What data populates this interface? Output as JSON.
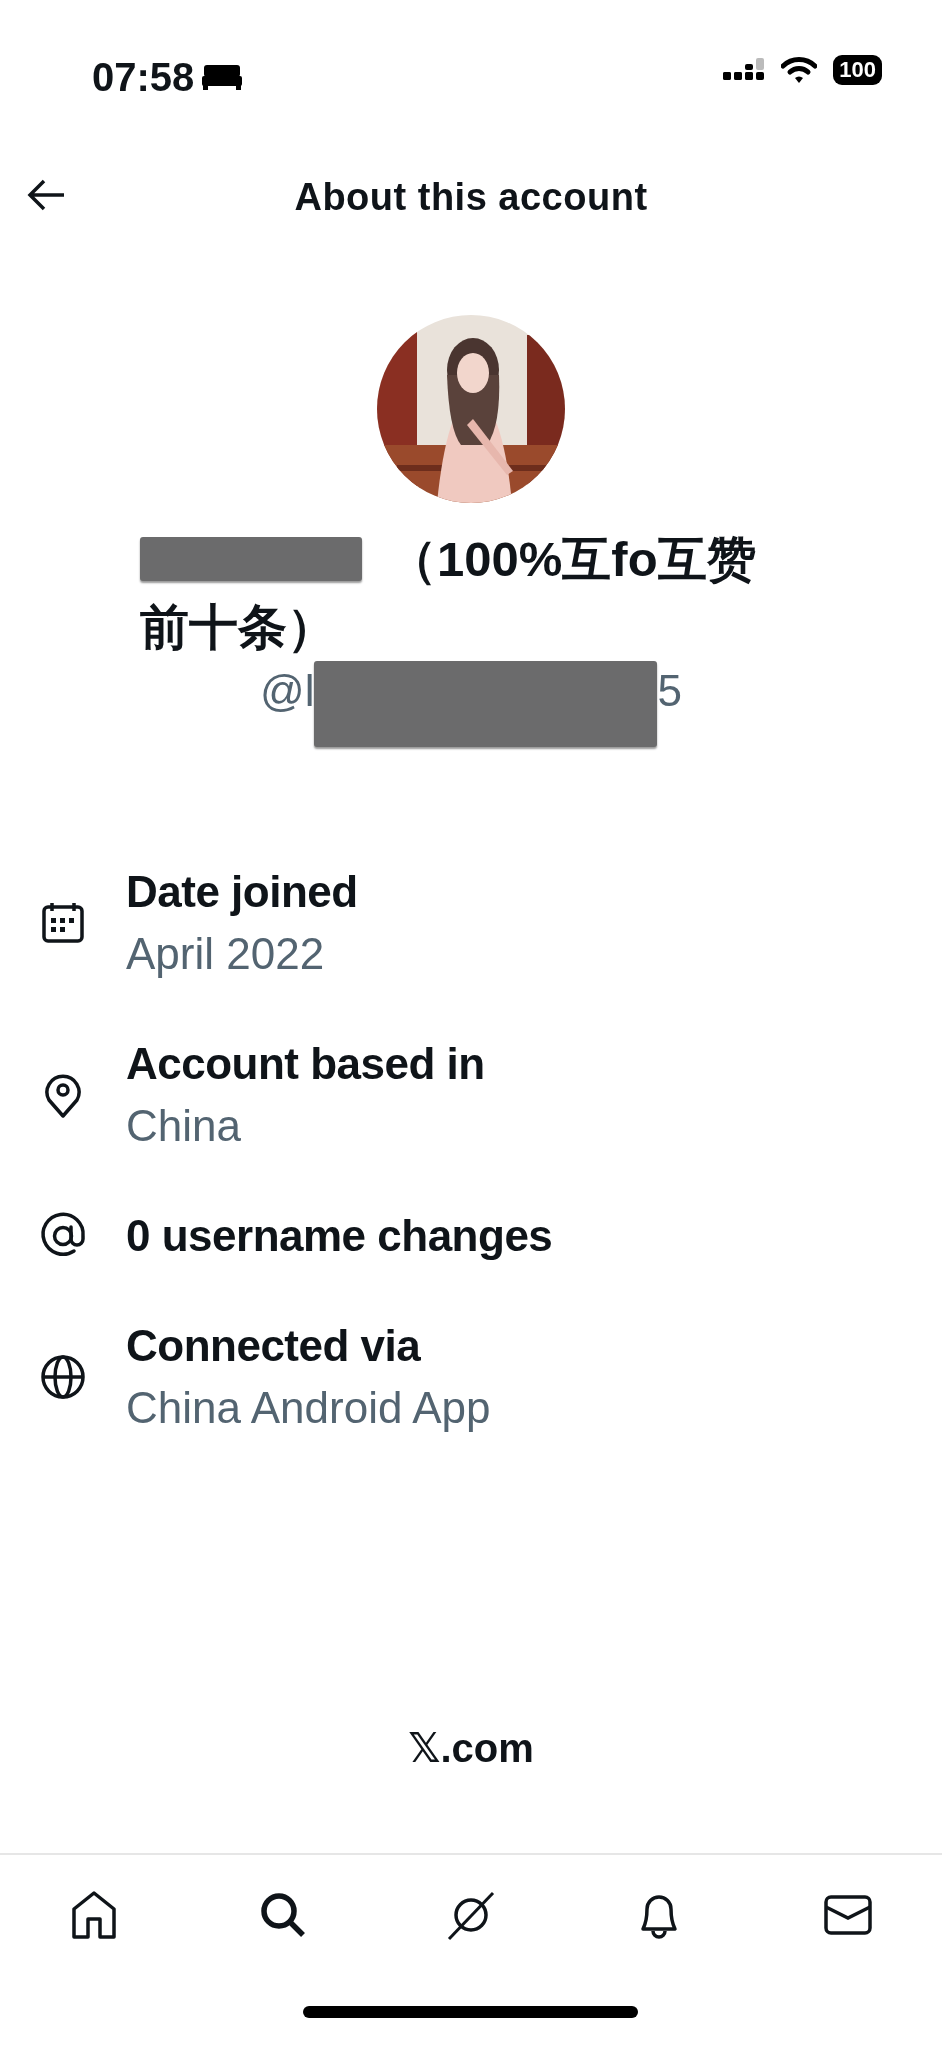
{
  "status_bar": {
    "time": "07:58",
    "battery": "100"
  },
  "header": {
    "title": "About this account"
  },
  "profile": {
    "name_line_1": "（100%互fo互赞",
    "name_line_2": "前十条）",
    "handle_start": "@l",
    "handle_end": "5"
  },
  "details": [
    {
      "kind": "two_line",
      "label": "Date joined",
      "value": "April 2022"
    },
    {
      "kind": "two_line",
      "label": "Account based in",
      "value": "China"
    },
    {
      "kind": "single",
      "label": "0 username changes"
    },
    {
      "kind": "two_line",
      "label": "Connected via",
      "value": "China Android App"
    }
  ],
  "footer": {
    "site": "𝕏.com"
  }
}
